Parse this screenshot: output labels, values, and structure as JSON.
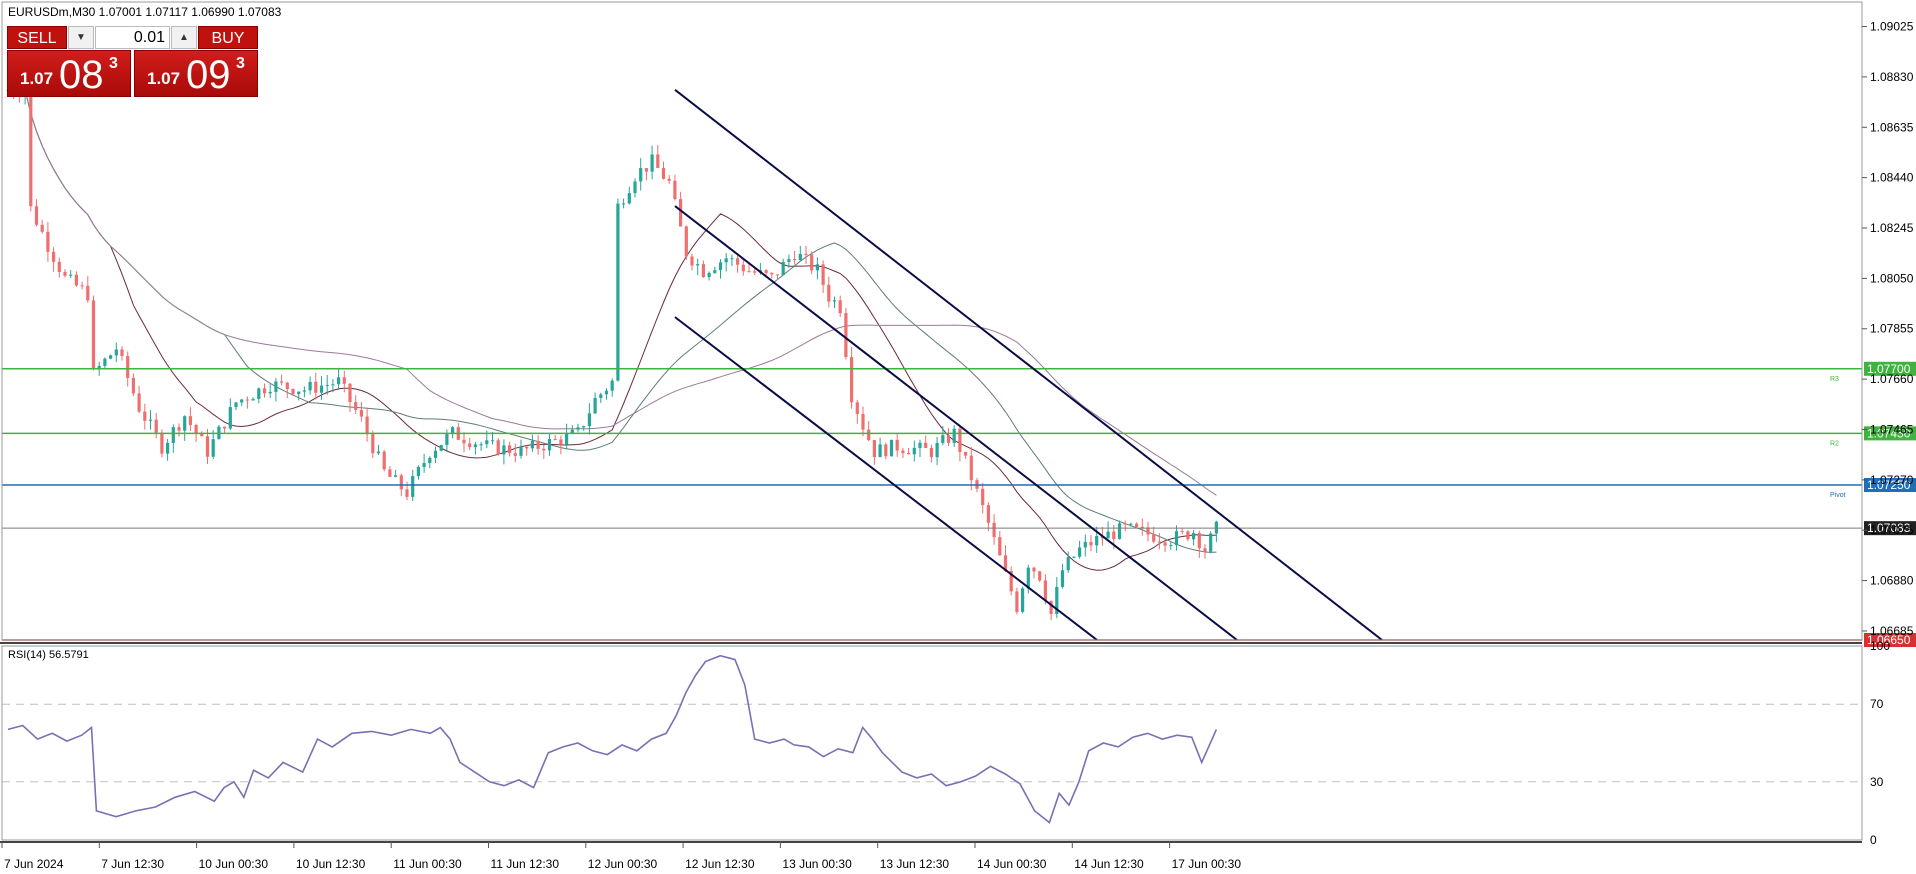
{
  "symbol_header": "EURUSDm,M30  1.07001 1.07117 1.06990 1.07083",
  "trade_panel": {
    "sell_label": "SELL",
    "buy_label": "BUY",
    "volume": "0.01",
    "sell_price_small": "1.07",
    "sell_price_big": "08",
    "sell_price_sup": "3",
    "buy_price_small": "1.07",
    "buy_price_big": "09",
    "buy_price_sup": "3",
    "dec_icon": "down-arrow-icon",
    "inc_icon": "up-arrow-icon"
  },
  "colors": {
    "bull": "#26a69a",
    "bear": "#ef6e6e",
    "channel": "#0b0b45",
    "r_level": "#3db43d",
    "pivot": "#1d6fb8",
    "s_level": "#d93030",
    "price_line": "#7a7a7a",
    "rsi": "#7b6fb3",
    "ma_fast": "#6b2a3a",
    "ma_mid": "#5e7d78",
    "ma_slow": "#9a7b9a"
  },
  "chart_data": [
    {
      "type": "candlestick",
      "symbol": "EURUSDm",
      "timeframe": "M30",
      "ylim": [
        1.0665,
        1.0912
      ],
      "y_ticks": [
        "1.09025",
        "1.08830",
        "1.08635",
        "1.08440",
        "1.08245",
        "1.08050",
        "1.07855",
        "1.07660",
        "1.07465",
        "1.07270",
        "1.07075",
        "1.06880",
        "1.06685"
      ],
      "x_ticks": [
        "7 Jun 2024",
        "7 Jun 12:30",
        "10 Jun 00:30",
        "10 Jun 12:30",
        "11 Jun 00:30",
        "11 Jun 12:30",
        "12 Jun 00:30",
        "12 Jun 12:30",
        "13 Jun 00:30",
        "13 Jun 12:30",
        "14 Jun 00:30",
        "14 Jun 12:30",
        "17 Jun 00:30"
      ],
      "price_path": [
        [
          0,
          1.0878
        ],
        [
          3,
          1.0878
        ],
        [
          4,
          1.0832
        ],
        [
          7,
          1.0818
        ],
        [
          10,
          1.0805
        ],
        [
          14,
          1.0799
        ],
        [
          15,
          1.0768
        ],
        [
          19,
          1.0778
        ],
        [
          23,
          1.0755
        ],
        [
          27,
          1.074
        ],
        [
          31,
          1.0752
        ],
        [
          35,
          1.0738
        ],
        [
          40,
          1.0757
        ],
        [
          46,
          1.0764
        ],
        [
          52,
          1.0762
        ],
        [
          58,
          1.0765
        ],
        [
          62,
          1.075
        ],
        [
          66,
          1.073
        ],
        [
          70,
          1.0722
        ],
        [
          74,
          1.0738
        ],
        [
          78,
          1.0745
        ],
        [
          84,
          1.074
        ],
        [
          90,
          1.0738
        ],
        [
          96,
          1.0742
        ],
        [
          100,
          1.0745
        ],
        [
          103,
          1.0758
        ],
        [
          106,
          1.0765
        ],
        [
          107,
          1.0833
        ],
        [
          110,
          1.0845
        ],
        [
          113,
          1.085
        ],
        [
          116,
          1.0842
        ],
        [
          119,
          1.0815
        ],
        [
          122,
          1.0808
        ],
        [
          126,
          1.0813
        ],
        [
          130,
          1.0808
        ],
        [
          134,
          1.0805
        ],
        [
          138,
          1.0815
        ],
        [
          142,
          1.0808
        ],
        [
          144,
          1.0798
        ],
        [
          146,
          1.0794
        ],
        [
          148,
          1.076
        ],
        [
          150,
          1.0748
        ],
        [
          152,
          1.0738
        ],
        [
          156,
          1.074
        ],
        [
          162,
          1.0738
        ],
        [
          166,
          1.0745
        ],
        [
          169,
          1.0728
        ],
        [
          172,
          1.071
        ],
        [
          175,
          1.069
        ],
        [
          177,
          1.0678
        ],
        [
          179,
          1.0695
        ],
        [
          181,
          1.069
        ],
        [
          183,
          1.0675
        ],
        [
          185,
          1.0692
        ],
        [
          188,
          1.07
        ],
        [
          192,
          1.0705
        ],
        [
          196,
          1.0708
        ],
        [
          200,
          1.0706
        ],
        [
          204,
          1.0704
        ],
        [
          208,
          1.0707
        ],
        [
          210,
          1.07
        ],
        [
          212,
          1.0708
        ]
      ],
      "channel_lines": [
        {
          "name": "upper",
          "from": [
            675,
            1.0878
          ],
          "to": [
            1382,
            1.0665
          ]
        },
        {
          "name": "middle",
          "from": [
            675,
            1.0833
          ],
          "to": [
            1237,
            1.0665
          ]
        },
        {
          "name": "lower",
          "from": [
            675,
            1.079
          ],
          "to": [
            1097,
            1.0665
          ]
        }
      ],
      "levels": [
        {
          "label": "R3",
          "value": "1.07700",
          "y": 1.077,
          "kind": "r"
        },
        {
          "label": "R2",
          "value": "1.07450",
          "y": 1.0745,
          "kind": "r"
        },
        {
          "label": "Pivot",
          "value": "1.07250",
          "y": 1.0725,
          "kind": "pivot"
        },
        {
          "label": "",
          "value": "1.07083",
          "y": 1.07083,
          "kind": "price"
        },
        {
          "label": "",
          "value": "1.06650",
          "y": 1.0665,
          "kind": "s"
        }
      ]
    },
    {
      "type": "line",
      "title": "RSI(14) 56.5791",
      "ylim": [
        0,
        100
      ],
      "y_ticks": [
        "100",
        "70",
        "30",
        "0"
      ],
      "levels": [
        70,
        30
      ],
      "rsi_path": [
        [
          0,
          57
        ],
        [
          3,
          59
        ],
        [
          6,
          52
        ],
        [
          9,
          55
        ],
        [
          12,
          51
        ],
        [
          15,
          54
        ],
        [
          17,
          58
        ],
        [
          18,
          15
        ],
        [
          22,
          12
        ],
        [
          26,
          15
        ],
        [
          30,
          17
        ],
        [
          34,
          22
        ],
        [
          38,
          25
        ],
        [
          42,
          20
        ],
        [
          44,
          27
        ],
        [
          46,
          30
        ],
        [
          48,
          22
        ],
        [
          50,
          36
        ],
        [
          53,
          32
        ],
        [
          56,
          40
        ],
        [
          60,
          35
        ],
        [
          63,
          52
        ],
        [
          66,
          48
        ],
        [
          70,
          55
        ],
        [
          74,
          56
        ],
        [
          78,
          54
        ],
        [
          82,
          57
        ],
        [
          86,
          55
        ],
        [
          88,
          58
        ],
        [
          90,
          52
        ],
        [
          92,
          40
        ],
        [
          95,
          35
        ],
        [
          98,
          30
        ],
        [
          101,
          28
        ],
        [
          104,
          31
        ],
        [
          107,
          27
        ],
        [
          110,
          45
        ],
        [
          113,
          48
        ],
        [
          116,
          50
        ],
        [
          119,
          46
        ],
        [
          122,
          44
        ],
        [
          125,
          49
        ],
        [
          128,
          46
        ],
        [
          131,
          52
        ],
        [
          134,
          55
        ],
        [
          136,
          64
        ],
        [
          138,
          76
        ],
        [
          140,
          85
        ],
        [
          142,
          92
        ],
        [
          145,
          95
        ],
        [
          148,
          93
        ],
        [
          150,
          80
        ],
        [
          152,
          52
        ],
        [
          155,
          50
        ],
        [
          158,
          52
        ],
        [
          160,
          49
        ],
        [
          163,
          48
        ],
        [
          166,
          43
        ],
        [
          169,
          47
        ],
        [
          172,
          45
        ],
        [
          174,
          58
        ],
        [
          176,
          52
        ],
        [
          178,
          45
        ],
        [
          180,
          40
        ],
        [
          182,
          35
        ],
        [
          185,
          32
        ],
        [
          188,
          34
        ],
        [
          191,
          28
        ],
        [
          194,
          30
        ],
        [
          197,
          33
        ],
        [
          200,
          38
        ],
        [
          203,
          34
        ],
        [
          206,
          29
        ],
        [
          209,
          15
        ],
        [
          212,
          9
        ],
        [
          214,
          24
        ],
        [
          216,
          18
        ],
        [
          218,
          30
        ],
        [
          220,
          46
        ],
        [
          223,
          50
        ],
        [
          226,
          48
        ],
        [
          229,
          53
        ],
        [
          232,
          55
        ],
        [
          235,
          52
        ],
        [
          238,
          54
        ],
        [
          241,
          53
        ],
        [
          243,
          40
        ],
        [
          246,
          57
        ]
      ]
    }
  ]
}
